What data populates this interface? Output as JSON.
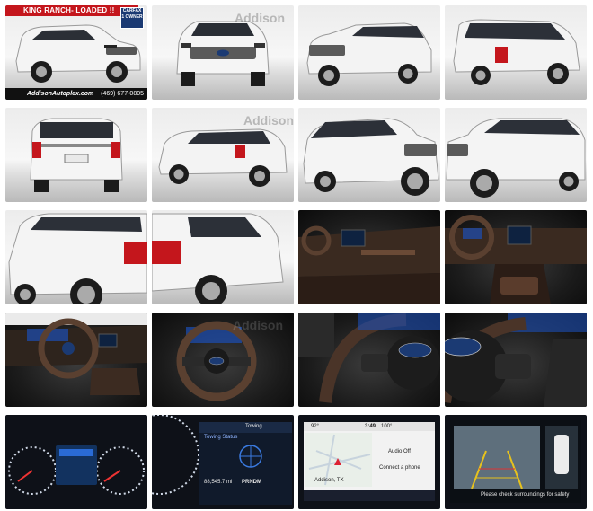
{
  "gallery": {
    "banner": "KING RANCH- LOADED !!",
    "badge_line1": "CARFAX",
    "badge_line2": "1 OWNER",
    "dealer_site": "AddisonAutoplex.com",
    "dealer_phone": "(469) 677-0805",
    "watermark": "Addison",
    "tiles": [
      {
        "kind": "exterior",
        "view": "front-three-quarter-left"
      },
      {
        "kind": "exterior",
        "view": "front"
      },
      {
        "kind": "exterior",
        "view": "front-three-quarter-left"
      },
      {
        "kind": "exterior",
        "view": "rear-three-quarter-left"
      },
      {
        "kind": "exterior",
        "view": "rear"
      },
      {
        "kind": "exterior",
        "view": "rear-three-quarter-left"
      },
      {
        "kind": "exterior",
        "view": "front-three-quarter-left-close"
      },
      {
        "kind": "exterior",
        "view": "front-three-quarter-right-close"
      },
      {
        "kind": "exterior",
        "view": "rear-three-quarter-right-close"
      },
      {
        "kind": "exterior",
        "view": "rear-quarter-right"
      },
      {
        "kind": "interior",
        "view": "dashboard-passenger"
      },
      {
        "kind": "interior",
        "view": "dashboard-center"
      },
      {
        "kind": "interior",
        "view": "cockpit-driver"
      },
      {
        "kind": "interior",
        "view": "steering-wheel"
      },
      {
        "kind": "interior",
        "view": "wheel-close"
      },
      {
        "kind": "interior",
        "view": "wheel-logo-close"
      },
      {
        "kind": "screen",
        "view": "instrument-cluster"
      },
      {
        "kind": "screen",
        "view": "cluster-towing"
      },
      {
        "kind": "screen",
        "view": "infotainment"
      },
      {
        "kind": "screen",
        "view": "camera-view"
      }
    ],
    "towing": {
      "title": "Towing",
      "status": "Towing Status",
      "odometer": "88,545.7 mi",
      "gear": "PRNDM"
    },
    "infotainment": {
      "time": "3:49",
      "temp": "100°",
      "audio": "Audio Off",
      "phone": "Connect a phone",
      "location": "Addison, TX",
      "outside_temp": "92°"
    },
    "camera": {
      "warning": "Please check surroundings for safety"
    }
  }
}
